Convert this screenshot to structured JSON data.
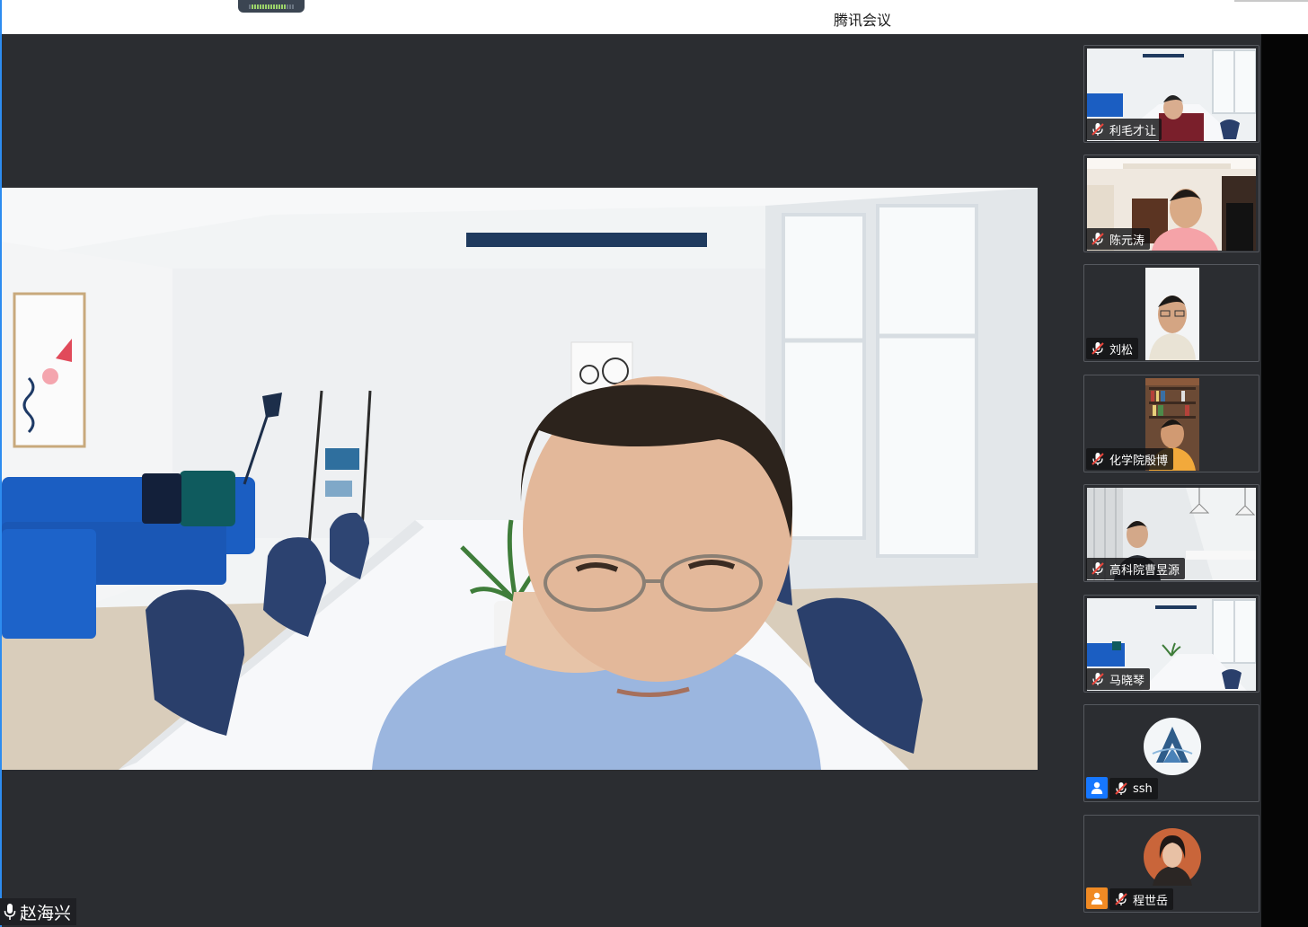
{
  "window": {
    "title": "腾讯会议"
  },
  "main": {
    "speaker_name": "赵海兴"
  },
  "participants": [
    {
      "name": "利毛才让",
      "muted": true,
      "bg": "room"
    },
    {
      "name": "陈元涛",
      "muted": true,
      "bg": "office"
    },
    {
      "name": "刘松",
      "muted": true,
      "bg": "portrait"
    },
    {
      "name": "化学院殷博",
      "muted": true,
      "bg": "bookshelf"
    },
    {
      "name": "高科院曹昱源",
      "muted": true,
      "bg": "studio"
    },
    {
      "name": "马晓琴",
      "muted": true,
      "bg": "room"
    },
    {
      "name": "ssh",
      "muted": true,
      "avatar": "logo",
      "badge_color": "#1677ff"
    },
    {
      "name": "程世岳",
      "muted": true,
      "avatar": "photo",
      "badge_color": "#f08a24"
    }
  ]
}
